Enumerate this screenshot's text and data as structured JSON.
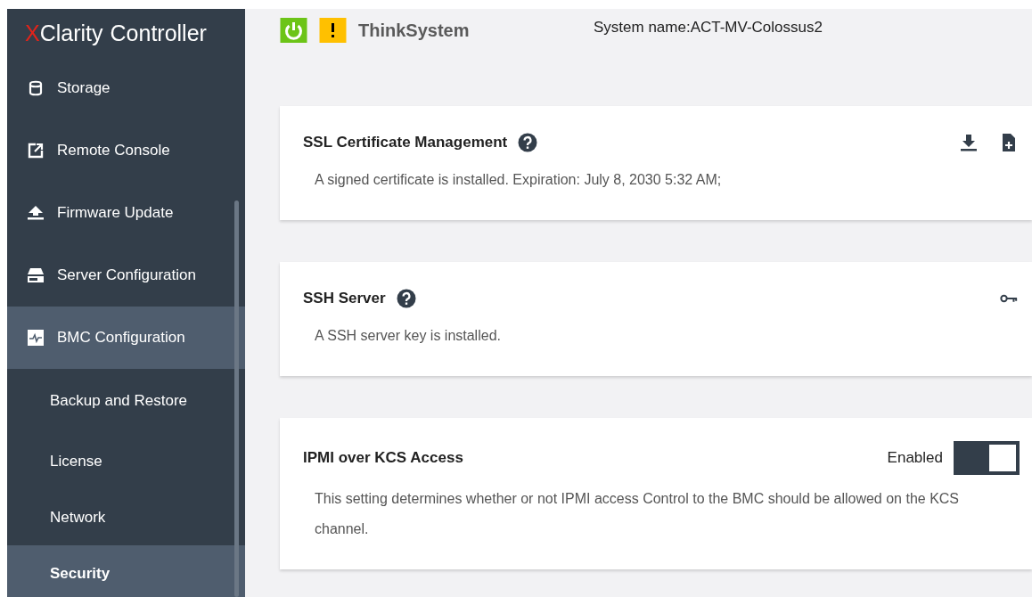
{
  "logo": {
    "mark": "X",
    "name": "Clarity",
    "product": "Controller"
  },
  "sidebar": {
    "items": [
      {
        "label": "Storage",
        "selected": false
      },
      {
        "label": "Remote Console",
        "selected": false
      },
      {
        "label": "Firmware Update",
        "selected": false
      },
      {
        "label": "Server Configuration",
        "selected": false
      },
      {
        "label": "BMC Configuration",
        "selected": false,
        "expanded": true,
        "children": [
          {
            "label": "Backup and Restore",
            "selected": false
          },
          {
            "label": "License",
            "selected": false
          },
          {
            "label": "Network",
            "selected": false
          },
          {
            "label": "Security",
            "selected": true
          }
        ]
      }
    ]
  },
  "header": {
    "status": [
      {
        "kind": "power",
        "color": "#6cc417"
      },
      {
        "kind": "warning",
        "color": "#ffc000"
      }
    ],
    "product": "ThinkSystem",
    "system_name": "System name:ACT-MV-Colossus2"
  },
  "cards": [
    {
      "title": "SSL Certificate Management",
      "help": true,
      "actions": [
        {
          "kind": "download"
        },
        {
          "kind": "add-file"
        }
      ],
      "description": "A signed certificate is installed. Expiration: July 8, 2030 5:32 AM;"
    },
    {
      "title": "SSH Server",
      "help": true,
      "actions": [
        {
          "kind": "key"
        }
      ],
      "description": "A SSH server key is installed."
    },
    {
      "title": "IPMI over KCS Access",
      "help": false,
      "toggle": {
        "label": "Enabled",
        "on": true
      },
      "description": "This setting determines whether or not IPMI access Control to the BMC should be allowed on the KCS channel."
    }
  ]
}
